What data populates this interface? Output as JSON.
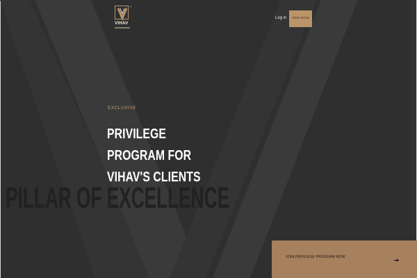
{
  "brand": {
    "name": "VIHAV",
    "tm": "™",
    "colors": {
      "gold": "#bc956a",
      "background": "#2f2f2f",
      "panel": "#a7805e"
    }
  },
  "header": {
    "login_label": "Log in",
    "join_label": "JOIN NOW"
  },
  "hero": {
    "kicker": "EXCLUSIVE",
    "headline_line1": "PRIVILEGE PROGRAM FOR",
    "headline_line2": "VIHAV'S CLIENTS",
    "background_text": "PILLAR OF EXCELLENCE"
  },
  "cta": {
    "label": "JOIN PRIVILEGE PROGRAM NOW",
    "icon": "arrow-right-icon"
  }
}
